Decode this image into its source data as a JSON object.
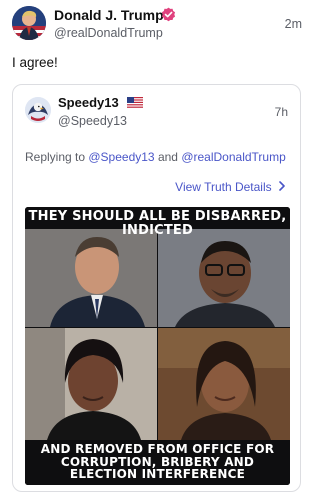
{
  "post": {
    "author_name": "Donald J. Trump",
    "author_handle": "@realDonaldTrump",
    "time": "2m",
    "body": "I agree!",
    "avatar_icon": "trump-avatar",
    "verified_icon": "verified-badge-icon",
    "verified_color": "#e0427e"
  },
  "quote": {
    "author_name": "Speedy13",
    "flag_icon": "us-flag-icon",
    "author_handle": "@Speedy13",
    "time": "7h",
    "replying_prefix": "Replying to ",
    "mention_1": "@Speedy13",
    "replying_and": " and ",
    "mention_2": "@realDonaldTrump",
    "view_details": "View Truth Details",
    "view_details_icon": "chevron-right-icon",
    "link_color": "#4a56c8",
    "meme": {
      "caption_top_line1": "THEY SHOULD ALL BE DISBARRED,",
      "caption_top_line2": "INDICTED",
      "caption_bottom_line1": "AND REMOVED FROM OFFICE FOR",
      "caption_bottom_line2": "CORRUPTION, BRIBERY AND",
      "caption_bottom_line3": "ELECTION INTERFERENCE"
    }
  }
}
